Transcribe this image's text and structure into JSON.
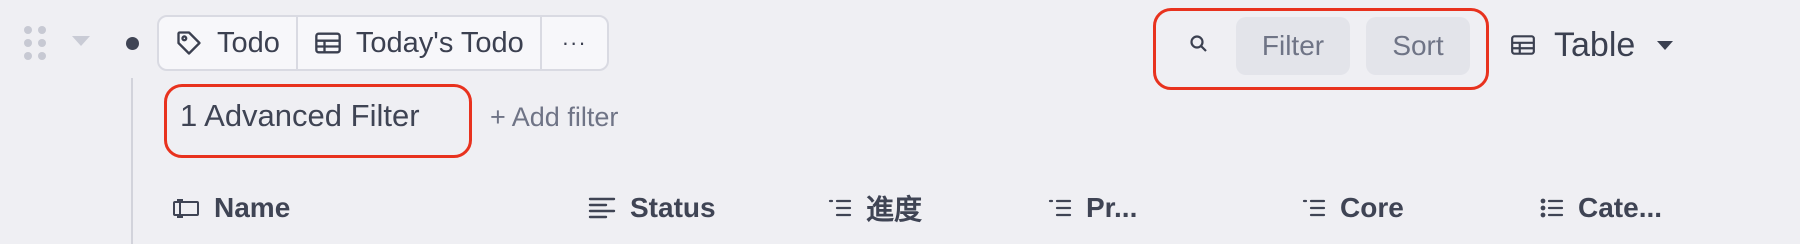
{
  "view_tags": {
    "tag_label": "Todo",
    "view_label": "Today's Todo",
    "more_label": "···"
  },
  "toolbar": {
    "filter_label": "Filter",
    "sort_label": "Sort",
    "view_type_label": "Table"
  },
  "filters": {
    "advanced_label": "1 Advanced Filter",
    "add_filter_label": "+ Add filter"
  },
  "columns": [
    {
      "label": "Name",
      "icon": "text-field-icon"
    },
    {
      "label": "Status",
      "icon": "align-left-icon"
    },
    {
      "label": "進度",
      "icon": "list-icon"
    },
    {
      "label": "Pr...",
      "icon": "list-icon"
    },
    {
      "label": "Core",
      "icon": "list-icon"
    },
    {
      "label": "Cate...",
      "icon": "bulleted-list-icon"
    }
  ],
  "colors": {
    "background": "#efeff3",
    "annotation_red": "#e8321e",
    "pill_bg": "#e3e4ea",
    "text": "#3f4454",
    "muted_text": "#6f7486"
  }
}
